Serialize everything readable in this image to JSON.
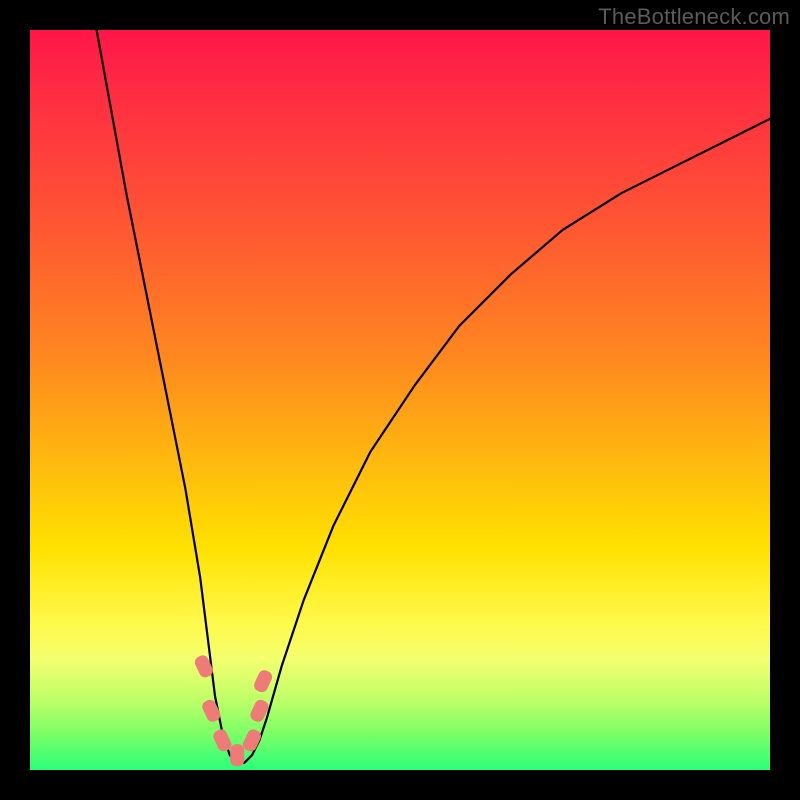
{
  "attribution": "TheBottleneck.com",
  "chart_data": {
    "type": "line",
    "title": "",
    "xlabel": "",
    "ylabel": "",
    "xlim": [
      0,
      100
    ],
    "ylim": [
      0,
      100
    ],
    "series": [
      {
        "name": "curve",
        "x": [
          9,
          11,
          13,
          15,
          17,
          19,
          21,
          23,
          24,
          25,
          26,
          27,
          28,
          29,
          30,
          31,
          32,
          34,
          37,
          41,
          46,
          52,
          58,
          65,
          72,
          80,
          88,
          96,
          100
        ],
        "y": [
          100,
          89,
          78,
          68,
          58,
          48,
          38,
          26,
          18,
          10,
          5,
          2,
          1,
          1,
          2,
          4,
          7,
          14,
          23,
          33,
          43,
          52,
          60,
          67,
          73,
          78,
          82,
          86,
          88
        ]
      }
    ],
    "markers": [
      {
        "x": 23.5,
        "y": 14
      },
      {
        "x": 24.5,
        "y": 8
      },
      {
        "x": 26.0,
        "y": 4
      },
      {
        "x": 28.0,
        "y": 2
      },
      {
        "x": 30.0,
        "y": 4
      },
      {
        "x": 31.0,
        "y": 8
      },
      {
        "x": 31.5,
        "y": 12
      }
    ],
    "colors": {
      "curve": "#000000",
      "marker": "#ef7b78",
      "gradient_top": "#ff1648",
      "gradient_bottom": "#2bff79"
    }
  }
}
